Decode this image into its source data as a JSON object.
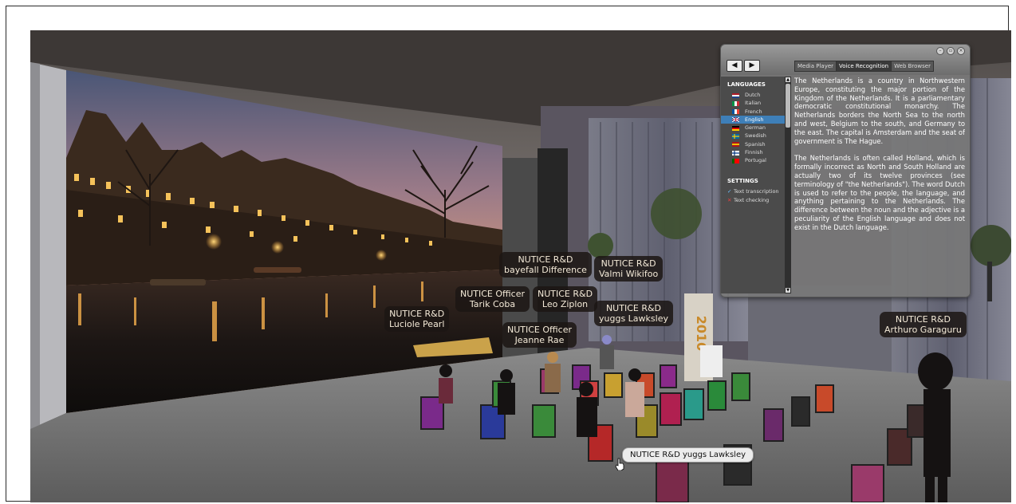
{
  "scene": {
    "name_tags": [
      {
        "line1": "NUTICE R&D",
        "line2": "bayefall Difference"
      },
      {
        "line1": "NUTICE R&D",
        "line2": "Valmi Wikifoo"
      },
      {
        "line1": "NUTICE Officer",
        "line2": "Tarik Coba"
      },
      {
        "line1": "NUTICE R&D",
        "line2": "Leo Ziplon"
      },
      {
        "line1": "NUTICE R&D",
        "line2": "yuggs Lawksley"
      },
      {
        "line1": "NUTICE R&D",
        "line2": "Luciole Pearl"
      },
      {
        "line1": "NUTICE Officer",
        "line2": "Jeanne Rae"
      },
      {
        "line1": "NUTICE R&D",
        "line2": "Arthuro Garaguru"
      }
    ],
    "hover_tooltip": "NUTICE R&D yuggs Lawksley",
    "sign_text": "2010"
  },
  "hud": {
    "nav": {
      "back": "◀",
      "forward": "▶"
    },
    "window_buttons": [
      "–",
      "▫",
      "×"
    ],
    "tabs": [
      {
        "label": "Media Player",
        "active": false
      },
      {
        "label": "Voice Recognition",
        "active": true
      },
      {
        "label": "Web Browser",
        "active": false
      }
    ],
    "languages_title": "LANGUAGES",
    "languages": [
      {
        "label": "Dutch",
        "flag": "nl",
        "selected": false
      },
      {
        "label": "Italian",
        "flag": "it",
        "selected": false
      },
      {
        "label": "French",
        "flag": "fr",
        "selected": false
      },
      {
        "label": "English",
        "flag": "gb",
        "selected": true
      },
      {
        "label": "German",
        "flag": "de",
        "selected": false
      },
      {
        "label": "Swedish",
        "flag": "se",
        "selected": false
      },
      {
        "label": "Spanish",
        "flag": "es",
        "selected": false
      },
      {
        "label": "Finnish",
        "flag": "fi",
        "selected": false
      },
      {
        "label": "Portugal",
        "flag": "pt",
        "selected": false
      }
    ],
    "settings_title": "SETTINGS",
    "settings": [
      {
        "label": "Text transcription",
        "state": "checked"
      },
      {
        "label": "Text checking",
        "state": "off"
      }
    ],
    "paragraphs": [
      "The Netherlands is a country in Northwestern Europe, constituting the major portion of the Kingdom of the Netherlands. It is a parliamentary democratic constitutional monarchy. The Netherlands borders the North Sea to the north and west, Belgium to the south, and Germany to the east. The capital is Amsterdam and the seat of government is The Hague.",
      "The Netherlands is often called Holland, which is formally incorrect as North and South Holland are actually two of its twelve provinces (see terminology of \"the Netherlands\"). The word Dutch is used to refer to the people, the language, and anything pertaining to the Netherlands. The difference between the noun and the adjective is a peculiarity of the English language and does not exist in the Dutch language."
    ]
  }
}
